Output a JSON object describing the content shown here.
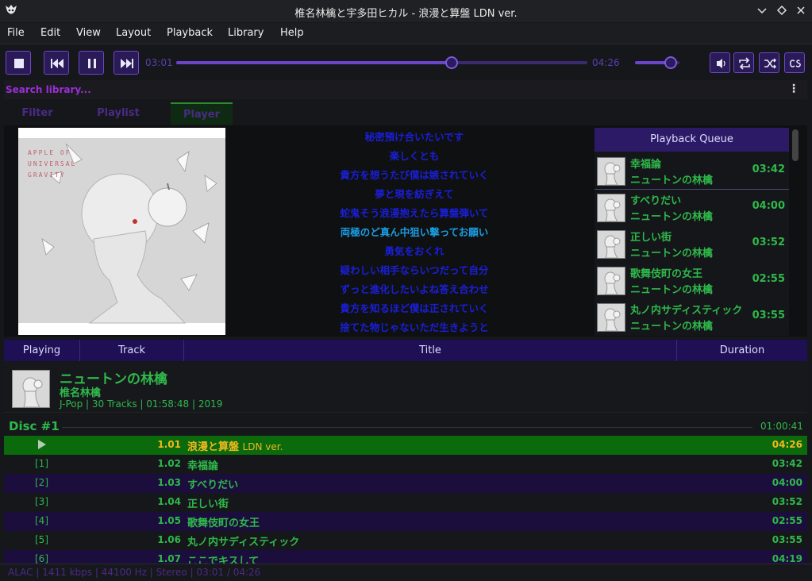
{
  "window": {
    "title": "椎名林檎と宇多田ヒカル - 浪漫と算盤",
    "title_suffix": "LDN ver."
  },
  "menu": [
    "File",
    "Edit",
    "View",
    "Layout",
    "Playback",
    "Library",
    "Help"
  ],
  "transport": {
    "elapsed": "03:01",
    "total": "04:26",
    "progress": 0.67,
    "volume": 0.8
  },
  "search": {
    "placeholder": "Search library..."
  },
  "tabs": [
    {
      "label": "Filter"
    },
    {
      "label": "Playlist Organizer"
    },
    {
      "label": "Player",
      "active": true
    }
  ],
  "lyrics": [
    "秘密預け合いたいです",
    "楽しくとも",
    "貴方を想うたび僕は嫉されていく",
    "夢と現を紡ぎえて",
    "蛇鬼そう浪漫抱えたら算盤弾いて",
    "両極のど真ん中狙い撃ってお願い",
    "勇気をおくれ",
    "疑わしい相手ならいつだって自分",
    "ずっと進化したいよね答え合わせ",
    "貴方を知るほど僕は正されていく",
    "捨てた物じゃないただ生きようと"
  ],
  "current_lyric_index": 5,
  "queue": {
    "header": "Playback Queue",
    "items": [
      {
        "title": "幸福論",
        "artist": "ニュートンの林檎",
        "duration": "03:42"
      },
      {
        "title": "すべりだい",
        "artist": "ニュートンの林檎",
        "duration": "04:00"
      },
      {
        "title": "正しい街",
        "artist": "ニュートンの林檎",
        "duration": "03:52"
      },
      {
        "title": "歌舞伎町の女王",
        "artist": "ニュートンの林檎",
        "duration": "02:55"
      },
      {
        "title": "丸ノ内サディスティック",
        "artist": "ニュートンの林檎",
        "duration": "03:55"
      }
    ]
  },
  "columns": [
    "Playing",
    "Track",
    "Title",
    "Duration"
  ],
  "album": {
    "title": "ニュートンの林檎",
    "artist": "椎名林檎",
    "meta": "J-Pop | 30 Tracks | 01:58:48 | 2019"
  },
  "disc": {
    "label": "Disc #1",
    "duration": "01:00:41"
  },
  "tracks": [
    {
      "playing": "▶",
      "num": "1.01",
      "title": "浪漫と算盤",
      "suffix": "LDN ver.",
      "duration": "04:26",
      "state": "playing"
    },
    {
      "playing": "[1]",
      "num": "1.02",
      "title": "幸福論",
      "duration": "03:42"
    },
    {
      "playing": "[2]",
      "num": "1.03",
      "title": "すべりだい",
      "duration": "04:00"
    },
    {
      "playing": "[3]",
      "num": "1.04",
      "title": "正しい街",
      "duration": "03:52"
    },
    {
      "playing": "[4]",
      "num": "1.05",
      "title": "歌舞伎町の女王",
      "duration": "02:55"
    },
    {
      "playing": "[5]",
      "num": "1.06",
      "title": "丸ノ内サディスティック",
      "duration": "03:55"
    },
    {
      "playing": "[6]",
      "num": "1.07",
      "title": "ここでキスして",
      "duration": "04:19"
    }
  ],
  "status": "ALAC | 1411 kbps | 44100 Hz | Stereo | 03:01 / 04:26",
  "colors": {
    "accent": "#6a48c8",
    "text_green": "#2fb84a",
    "playing_row": "#0b6a0b",
    "playing_text": "#f0b820",
    "header_bg": "#1f0f55",
    "lyric_color": "#1a1fd8",
    "lyric_current": "#1a9ce0"
  }
}
